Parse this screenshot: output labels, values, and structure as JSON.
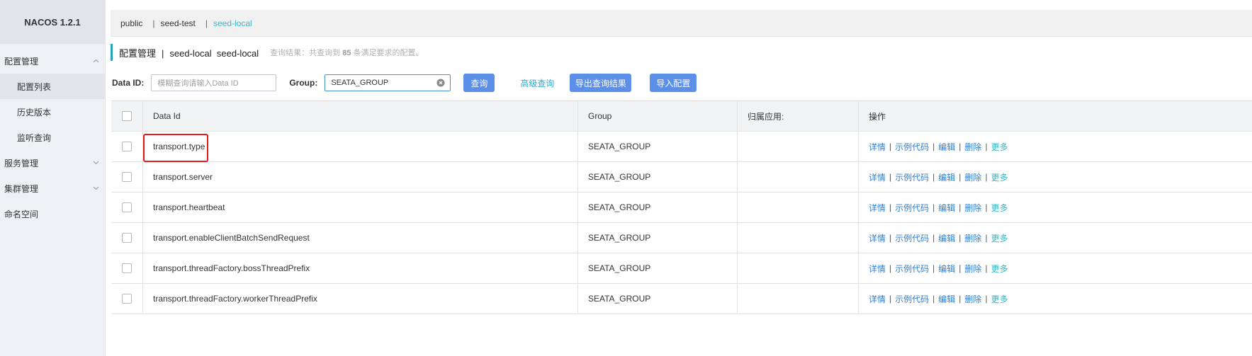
{
  "brand": "NACOS 1.2.1",
  "sidebar": {
    "items": [
      {
        "label": "配置管理",
        "expanded": true
      },
      {
        "label": "配置列表",
        "sub": true,
        "active": true
      },
      {
        "label": "历史版本",
        "sub": true
      },
      {
        "label": "监听查询",
        "sub": true
      },
      {
        "label": "服务管理",
        "expanded": false
      },
      {
        "label": "集群管理",
        "expanded": false
      },
      {
        "label": "命名空间"
      }
    ]
  },
  "namespaces": {
    "items": [
      "public",
      "seed-test",
      "seed-local"
    ],
    "separator": "|",
    "active": "seed-local"
  },
  "header": {
    "title": "配置管理",
    "sep": "|",
    "ns_name": "seed-local",
    "ns_id": "seed-local",
    "hint_prefix": "查询结果：共查询到",
    "hint_count": "85",
    "hint_suffix": "条满足要求的配置。"
  },
  "filters": {
    "dataid_label": "Data ID:",
    "dataid_placeholder": "模糊查询请输入Data ID",
    "group_label": "Group:",
    "group_value": "SEATA_GROUP",
    "query_button": "查询",
    "advanced_link": "高级查询",
    "export_button": "导出查询结果",
    "import_button": "导入配置"
  },
  "table": {
    "columns": [
      "Data Id",
      "Group",
      "归属应用:",
      "操作"
    ],
    "rows": [
      {
        "data_id": "transport.type",
        "group": "SEATA_GROUP",
        "app": ""
      },
      {
        "data_id": "transport.server",
        "group": "SEATA_GROUP",
        "app": ""
      },
      {
        "data_id": "transport.heartbeat",
        "group": "SEATA_GROUP",
        "app": ""
      },
      {
        "data_id": "transport.enableClientBatchSendRequest",
        "group": "SEATA_GROUP",
        "app": ""
      },
      {
        "data_id": "transport.threadFactory.bossThreadPrefix",
        "group": "SEATA_GROUP",
        "app": ""
      },
      {
        "data_id": "transport.threadFactory.workerThreadPrefix",
        "group": "SEATA_GROUP",
        "app": ""
      }
    ],
    "ops": {
      "detail": "详情",
      "sample": "示例代码",
      "edit": "编辑",
      "delete": "删除",
      "more": "更多",
      "sep": "|"
    }
  },
  "colors": {
    "primary_button": "#5b8fe8",
    "link": "#2f7fd1",
    "accent": "#33b8c8",
    "highlight_box": "#e01b1b"
  }
}
